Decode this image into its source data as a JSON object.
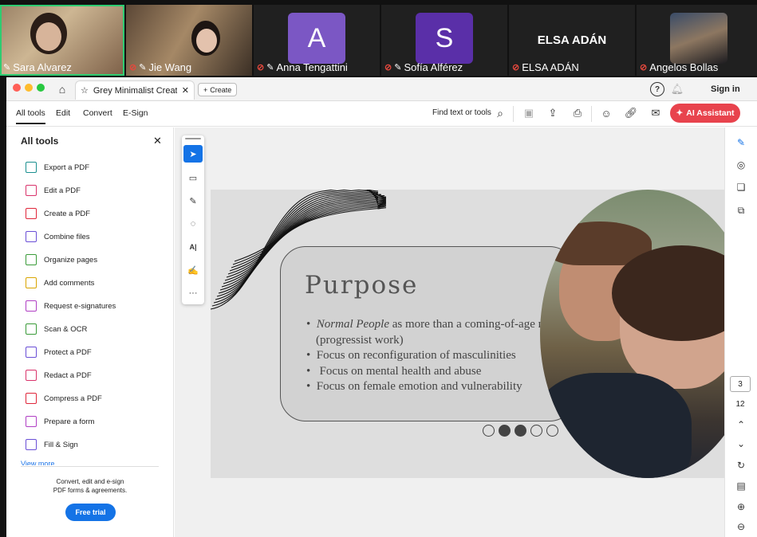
{
  "meeting": {
    "participants": [
      {
        "name": "Sara Alvarez",
        "type": "video",
        "active": true,
        "muted": false
      },
      {
        "name": "Jie Wang",
        "type": "video",
        "muted": true
      },
      {
        "name": "Anna Tengattini",
        "type": "avatar",
        "initial": "A",
        "color": "#7b57c4",
        "muted": true
      },
      {
        "name": "Sofía Alférez",
        "type": "avatar",
        "initial": "S",
        "color": "#5a2fa8",
        "muted": true
      },
      {
        "name": "ELSA ADÁN",
        "type": "name",
        "muted": true
      },
      {
        "name": "Angelos Bollas",
        "type": "video",
        "muted": true
      }
    ]
  },
  "browser": {
    "tab_title": "Grey Minimalist Creati...",
    "create_label": "Create",
    "signin_label": "Sign in"
  },
  "toolbar": {
    "menu": [
      "All tools",
      "Edit",
      "Convert",
      "E-Sign"
    ],
    "find_label": "Find text or tools",
    "ai_label": "AI Assistant"
  },
  "panel": {
    "title": "All tools",
    "tools": [
      {
        "label": "Export a PDF",
        "color": "#1a8f8f"
      },
      {
        "label": "Edit a PDF",
        "color": "#d9336b"
      },
      {
        "label": "Create a PDF",
        "color": "#e0263a"
      },
      {
        "label": "Combine files",
        "color": "#6a4fd6"
      },
      {
        "label": "Organize pages",
        "color": "#3a9b39"
      },
      {
        "label": "Add comments",
        "color": "#d9a500"
      },
      {
        "label": "Request e-signatures",
        "color": "#b03fc4"
      },
      {
        "label": "Scan & OCR",
        "color": "#3a9b39"
      },
      {
        "label": "Protect a PDF",
        "color": "#6a4fd6"
      },
      {
        "label": "Redact a PDF",
        "color": "#d9336b"
      },
      {
        "label": "Compress a PDF",
        "color": "#e0263a"
      },
      {
        "label": "Prepare a form",
        "color": "#b03fc4"
      },
      {
        "label": "Fill & Sign",
        "color": "#6a4fd6"
      }
    ],
    "view_more": "View more",
    "promo_line1": "Convert, edit and e-sign",
    "promo_line2": "PDF forms & agreements.",
    "trial_label": "Free trial"
  },
  "slide": {
    "title": "Purpose",
    "bullet1_italic": "Normal People",
    "bullet1_rest": " as more than a coming-of-age novel (progressist work)",
    "bullet2": "Focus on reconfiguration of masculinities",
    "bullet3": " Focus on mental health and abuse",
    "bullet4": "Focus on female emotion and vulnerability",
    "page_dots": [
      false,
      true,
      true,
      false,
      false
    ]
  },
  "pager": {
    "current": "3",
    "total": "12"
  }
}
